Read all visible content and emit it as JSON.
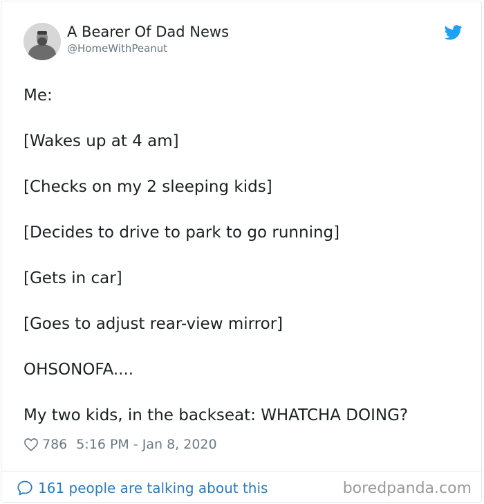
{
  "tweet": {
    "author": {
      "display_name": "A Bearer Of Dad News",
      "handle": "@HomeWithPeanut",
      "avatar_icon": "avatar-photo"
    },
    "brand_icon": "twitter-bird-icon",
    "brand_color": "#1da1f2",
    "lines": [
      "Me:",
      "[Wakes up at 4 am]",
      "[Checks on my 2 sleeping kids]",
      "[Decides to drive to park to go running]",
      "[Gets in car]",
      "[Goes to adjust rear-view mirror]",
      "OHSONOFA....",
      "My two kids, in the backseat: WHATCHA DOING?"
    ],
    "likes": "786",
    "timestamp": "5:16 PM - Jan 8, 2020",
    "conversation_text": "161 people are talking about this",
    "link_color": "#2b7bb9"
  },
  "watermark": {
    "text": "boredpanda.com"
  }
}
